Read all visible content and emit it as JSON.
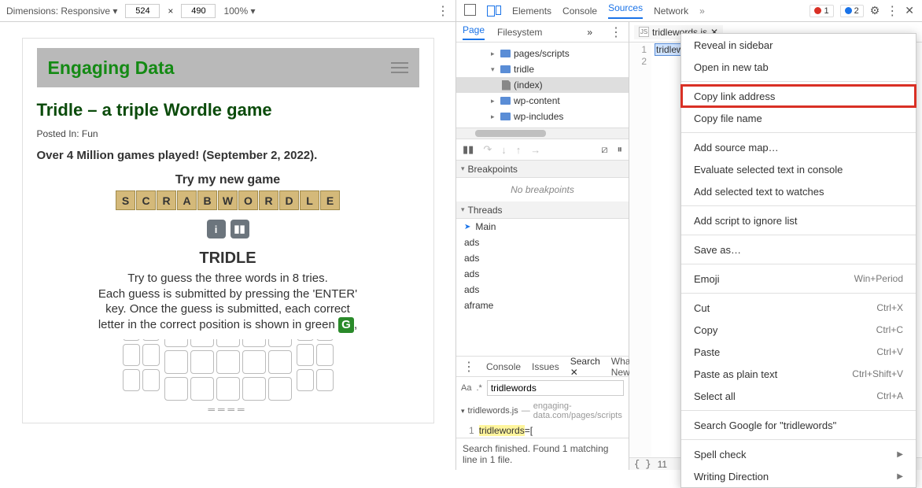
{
  "devtools_top": {
    "dimensions_label": "Dimensions: Responsive ▾",
    "width": "524",
    "height": "490",
    "zoom": "100% ▾",
    "tabs": [
      "Elements",
      "Console",
      "Sources",
      "Network"
    ],
    "active_tab": "Sources",
    "error_count": "1",
    "msg_count": "2"
  },
  "viewport": {
    "site_title": "Engaging Data",
    "page_title": "Tridle – a triple Wordle game",
    "posted_in": "Posted In: Fun",
    "subhead": "Over 4 Million games played! (September 2, 2022).",
    "try_new": "Try my new game",
    "scrabwordle": "SCRABWORDLE",
    "overlay": {
      "title": "TRIDLE",
      "line1": "Try to guess the three words in 8 tries.",
      "line2": "Each guess is submitted by pressing the 'ENTER' key. Once the guess is submitted, each correct letter in the correct position is shown in green",
      "g": "G"
    }
  },
  "sources": {
    "tabs": [
      "Page",
      "Filesystem"
    ],
    "tree": {
      "pages_scripts": "pages/scripts",
      "tridle": "tridle",
      "index": "(index)",
      "wp_content": "wp-content",
      "wp_includes": "wp-includes"
    },
    "breakpoints_header": "Breakpoints",
    "no_breakpoints": "No breakpoints",
    "threads_header": "Threads",
    "threads": [
      "Main",
      "ads",
      "ads",
      "ads",
      "ads",
      "aframe"
    ]
  },
  "editor": {
    "tab_name": "tridlewords.js",
    "line1_num": "1",
    "line2_num": "2",
    "code_sel": "tridlewords",
    "code_rest": "=[",
    "footer_num": "11"
  },
  "bottom_panel": {
    "tabs": [
      "Console",
      "Issues",
      "Search",
      "What's New"
    ],
    "active": "Search",
    "aa": "Aa",
    "regex": ".*",
    "query": "tridlewords",
    "result_file": "tridlewords.js",
    "result_path": "engaging-data.com/pages/scripts",
    "result_ln": "1",
    "result_hl": "tridlewords",
    "result_rest": "=[",
    "status": "Search finished. Found 1 matching line in 1 file."
  },
  "context_menu": {
    "items": [
      {
        "label": "Reveal in sidebar"
      },
      {
        "label": "Open in new tab"
      },
      {
        "sep": true
      },
      {
        "label": "Copy link address",
        "hl": true
      },
      {
        "label": "Copy file name"
      },
      {
        "sep": true
      },
      {
        "label": "Add source map…"
      },
      {
        "label": "Evaluate selected text in console"
      },
      {
        "label": "Add selected text to watches"
      },
      {
        "sep": true
      },
      {
        "label": "Add script to ignore list"
      },
      {
        "sep": true
      },
      {
        "label": "Save as…"
      },
      {
        "sep": true
      },
      {
        "label": "Emoji",
        "shortcut": "Win+Period"
      },
      {
        "sep": true
      },
      {
        "label": "Cut",
        "shortcut": "Ctrl+X"
      },
      {
        "label": "Copy",
        "shortcut": "Ctrl+C"
      },
      {
        "label": "Paste",
        "shortcut": "Ctrl+V"
      },
      {
        "label": "Paste as plain text",
        "shortcut": "Ctrl+Shift+V"
      },
      {
        "label": "Select all",
        "shortcut": "Ctrl+A"
      },
      {
        "sep": true
      },
      {
        "label": "Search Google for \"tridlewords\""
      },
      {
        "sep": true
      },
      {
        "label": "Spell check",
        "sub": true
      },
      {
        "label": "Writing Direction",
        "sub": true
      }
    ]
  }
}
